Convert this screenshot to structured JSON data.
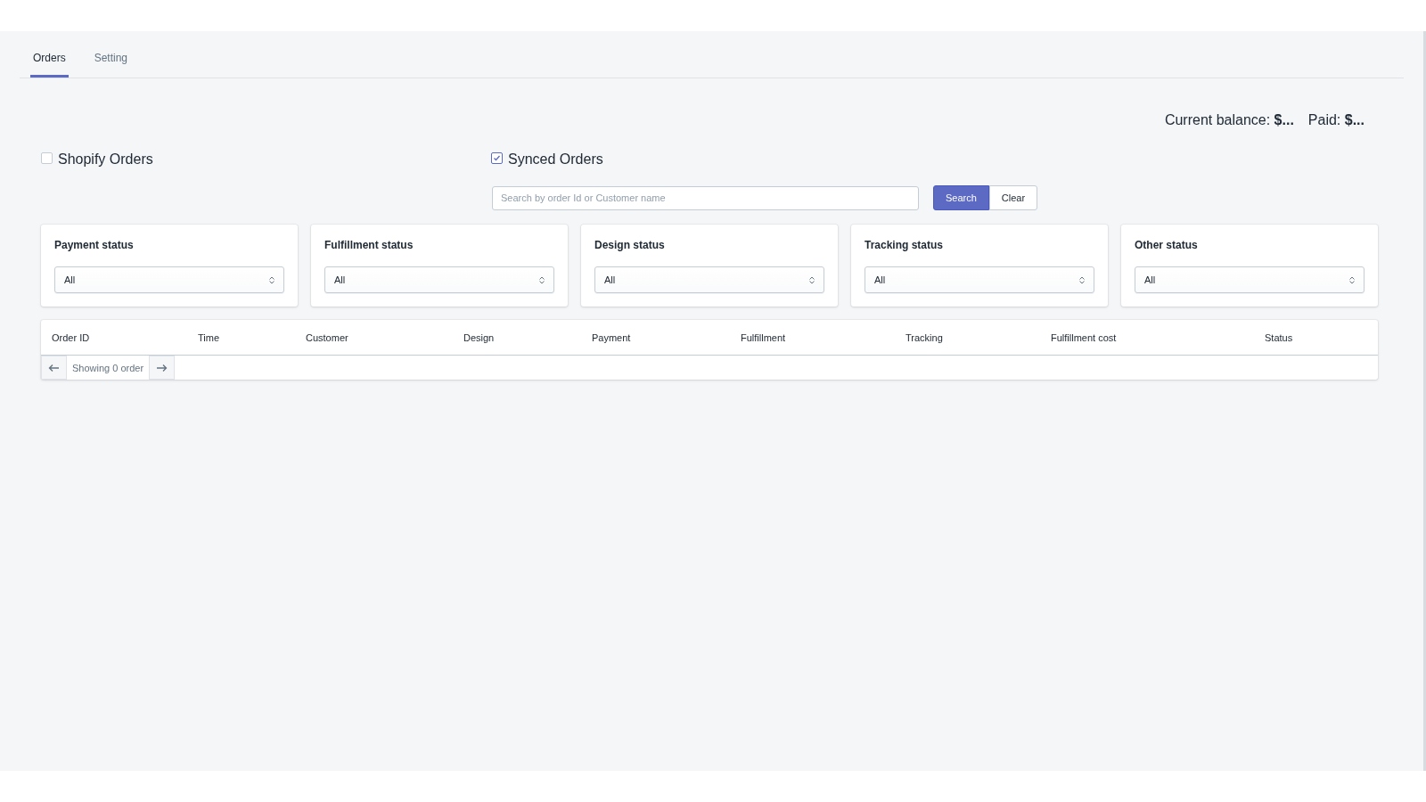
{
  "tabs": [
    {
      "label": "Orders",
      "selected": true
    },
    {
      "label": "Setting",
      "selected": false
    }
  ],
  "balance": {
    "current": "Current balance: **$...**",
    "paid": "Paid: **$...**"
  },
  "sources": [
    {
      "label": "Shopify Orders",
      "checked": false
    },
    {
      "label": "Synced Orders",
      "checked": true
    }
  ],
  "search": {
    "placeholder": "Search by order Id or Customer name",
    "search_button": "Search",
    "clear_button": "Clear"
  },
  "filters": [
    {
      "title": "Payment status",
      "value": "All"
    },
    {
      "title": "Fulfillment status",
      "value": "All"
    },
    {
      "title": "Design status",
      "value": "All"
    },
    {
      "title": "Tracking status",
      "value": "All"
    },
    {
      "title": "Other status",
      "value": "All"
    }
  ],
  "table": {
    "columns": [
      "Order ID",
      "Time",
      "Customer",
      "Design",
      "Payment",
      "Fulfillment",
      "Tracking",
      "Fulfillment cost",
      "Status"
    ]
  },
  "pagination": {
    "label": "Showing 0 order"
  }
}
